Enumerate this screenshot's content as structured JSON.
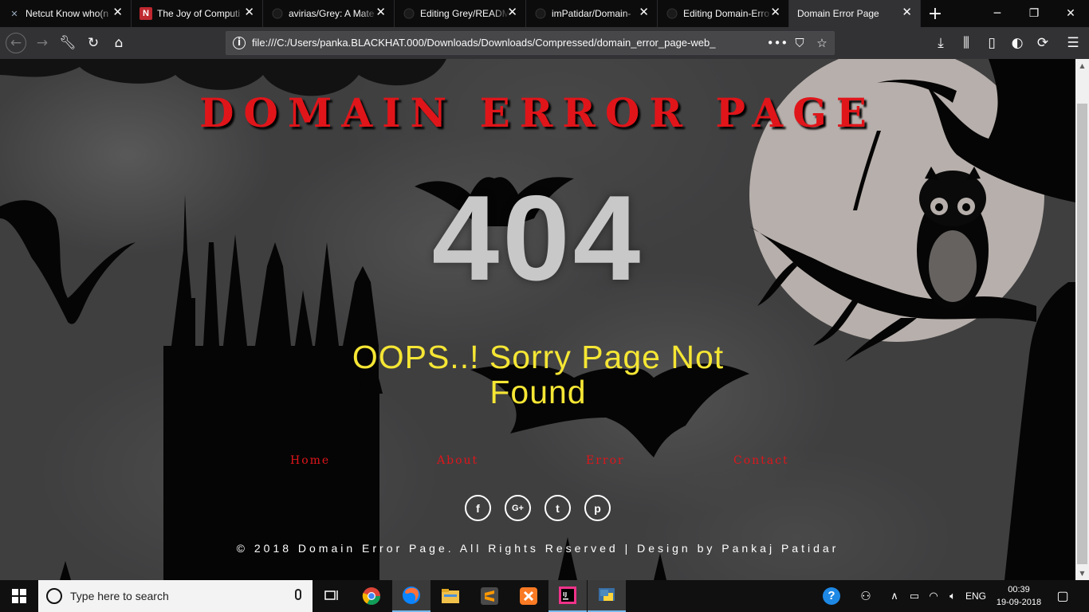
{
  "browser": {
    "tabs": [
      {
        "title": "Netcut Know who(n",
        "favicon": "netcut-icon"
      },
      {
        "title": "The Joy of Computi",
        "favicon": "notion-n-icon"
      },
      {
        "title": "avirias/Grey: A Mate",
        "favicon": "github-icon"
      },
      {
        "title": "Editing Grey/READM",
        "favicon": "github-icon"
      },
      {
        "title": "imPatidar/Domain-",
        "favicon": "github-icon"
      },
      {
        "title": "Editing Domain-Erro",
        "favicon": "github-icon"
      },
      {
        "title": "Domain Error Page",
        "favicon": "none",
        "active": true
      }
    ],
    "url": "file:///C:/Users/panka.BLACKHAT.000/Downloads/Downloads/Compressed/domain_error_page-web_"
  },
  "page": {
    "heading": "DOMAIN ERROR PAGE",
    "code": "404",
    "message": "OOPS..! Sorry Page Not Found",
    "menu": [
      "Home",
      "About",
      "Error",
      "Contact"
    ],
    "social": [
      "facebook-icon",
      "google-plus-icon",
      "twitter-icon",
      "pinterest-icon"
    ],
    "social_glyphs": [
      "f",
      "G+",
      "t",
      "p"
    ],
    "footer": "© 2018 Domain Error Page. All Rights Reserved | Design by Pankaj Patidar",
    "colors": {
      "heading": "#e0151a",
      "code": "#c8c8c8",
      "message": "#f5e634",
      "menu": "#e0151a"
    }
  },
  "taskbar": {
    "search_placeholder": "Type here to search",
    "apps": [
      "task-view-icon",
      "chrome-icon",
      "firefox-icon",
      "file-explorer-icon",
      "sublime-text-icon",
      "xampp-icon",
      "intellij-icon",
      "python-icon"
    ],
    "tray": {
      "language": "ENG",
      "time": "00:39",
      "date": "19-09-2018"
    }
  }
}
